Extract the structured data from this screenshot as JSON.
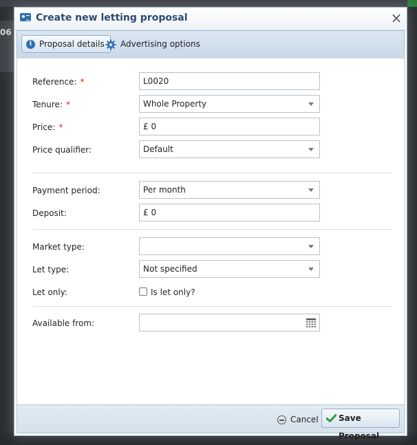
{
  "background": {
    "left_text": "06"
  },
  "dialog": {
    "title": "Create new letting proposal",
    "close_glyph": "×",
    "title_icon": "id-card-icon"
  },
  "tabs": [
    {
      "label": "Proposal details",
      "icon": "info-icon",
      "active": true
    },
    {
      "label": "Advertising options",
      "icon": "gear-icon",
      "active": false
    }
  ],
  "form": {
    "required_mark": "*",
    "reference": {
      "label": "Reference:",
      "value": "L0020",
      "required": true
    },
    "tenure": {
      "label": "Tenure:",
      "value": "Whole Property",
      "required": true
    },
    "price": {
      "label": "Price:",
      "value": "£ 0",
      "required": true
    },
    "price_qualifier": {
      "label": "Price qualifier:",
      "value": "Default"
    },
    "payment_period": {
      "label": "Payment period:",
      "value": "Per month"
    },
    "deposit": {
      "label": "Deposit:",
      "value": "£ 0"
    },
    "market_type": {
      "label": "Market type:",
      "value": ""
    },
    "let_type": {
      "label": "Let type:",
      "value": "Not specified"
    },
    "let_only": {
      "label": "Let only:",
      "checkbox_label": "Is let only?",
      "checked": false
    },
    "available_from": {
      "label": "Available from:",
      "value": ""
    }
  },
  "footer": {
    "cancel_label": "Cancel",
    "save_label": "Save Proposal"
  },
  "colors": {
    "title_text": "#2c4a6e",
    "required": "#e0241b",
    "accent": "#2f70b1",
    "save_check": "#2e9b3a"
  }
}
